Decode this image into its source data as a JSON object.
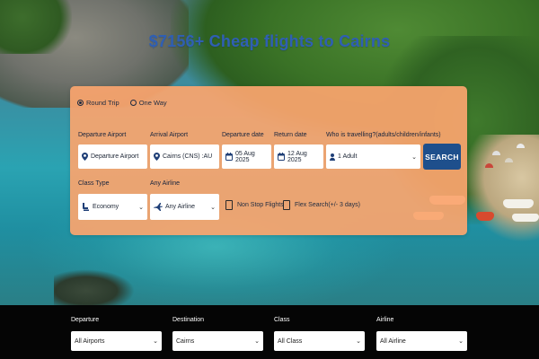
{
  "hero": {
    "title": "$7156+ Cheap flights to Cairns"
  },
  "search": {
    "trip_types": [
      {
        "label": "Round Trip",
        "selected": true
      },
      {
        "label": "One Way",
        "selected": false
      }
    ],
    "departure": {
      "label": "Departure Airport",
      "value": "Departure Airport",
      "icon": "map-pin-icon"
    },
    "arrival": {
      "label": "Arrival Airport",
      "value": "Cairns (CNS) :AU",
      "icon": "map-pin-icon"
    },
    "departure_date": {
      "label": "Departure date",
      "value": "05 Aug 2025",
      "icon": "calendar-icon"
    },
    "return_date": {
      "label": "Return date",
      "value": "12 Aug 2025",
      "icon": "calendar-icon"
    },
    "travellers": {
      "label": "Who is travelling?(adults/children/infants)",
      "value": "1 Adult",
      "icon": "person-icon"
    },
    "search_button": "SEARCH",
    "class_type": {
      "label": "Class Type",
      "value": "Economy",
      "icon": "seat-icon"
    },
    "airline": {
      "label": "Any Airline",
      "value": "Any Airline",
      "icon": "plane-icon"
    },
    "non_stop": {
      "label": "Non Stop Flights",
      "checked": false
    },
    "flex_search": {
      "label": "Flex Search(+/- 3 days)",
      "checked": false
    },
    "card_color": "#faa56e",
    "button_color": "#1e4f8c"
  },
  "filters": [
    {
      "label": "Departure",
      "value": "All Airports"
    },
    {
      "label": "Destination",
      "value": "Cairns"
    },
    {
      "label": "Class",
      "value": "All Class"
    },
    {
      "label": "Airline",
      "value": "All Airline"
    }
  ]
}
